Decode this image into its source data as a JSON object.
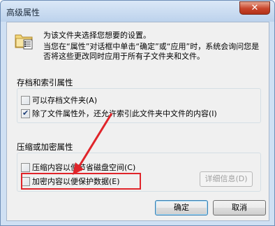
{
  "window": {
    "title": "高级属性",
    "close_label": "✕"
  },
  "intro": {
    "line1": "为该文件夹选择您想要的设置。",
    "line2": "当您在“属性”对话框中单击“确定”或“应用”时，系统会询问您是否将这些更改同时应用于所有子文件夹和文件。"
  },
  "archive_group": {
    "title": "存档和索引属性",
    "options": [
      {
        "label": "可以存档文件夹(A)",
        "checked": false
      },
      {
        "label": "除了文件属性外，还允许索引此文件夹中文件的内容(I)",
        "checked": true
      }
    ]
  },
  "compress_group": {
    "title": "压缩或加密属性",
    "options": [
      {
        "label": "压缩内容以便节省磁盘空间(C)",
        "checked": false
      },
      {
        "label": "加密内容以便保护数据(E)",
        "checked": false
      }
    ],
    "details_label": "详细信息(D)"
  },
  "buttons": {
    "ok": "确定",
    "cancel": "取消"
  },
  "annotation": {
    "color": "#e0242a"
  }
}
